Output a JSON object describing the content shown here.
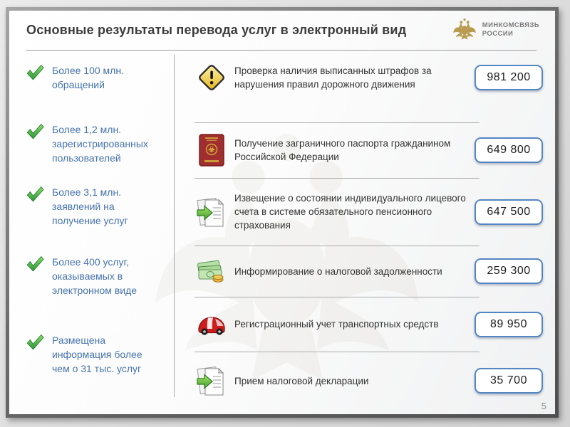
{
  "slide": {
    "title": "Основные результаты перевода услуг в электронный вид",
    "page_number": "5"
  },
  "logo": {
    "line1": "МИНКОМСВЯЗЬ",
    "line2": "РОССИИ"
  },
  "achievements": {
    "items": [
      {
        "text": "Более 100 млн. обращений"
      },
      {
        "text": "Более 1,2 млн. зарегистрированных пользователей"
      },
      {
        "text": "Более 3,1 млн. заявлений на получение услуг"
      },
      {
        "text": "Более 400 услуг, оказываемых в электронном виде"
      },
      {
        "text": "Размещена информация более чем о 31 тыс. услуг"
      }
    ]
  },
  "services": {
    "rows": [
      {
        "icon": "traffic-fine-warning-icon",
        "label": "Проверка наличия выписанных штрафов за нарушения правил дорожного движения",
        "value": "981 200"
      },
      {
        "icon": "passport-icon",
        "label": "Получение заграничного паспорта гражданином Российской Федерации",
        "value": "649 800"
      },
      {
        "icon": "document-arrow-icon",
        "label": "Извещение о состоянии индивидуального лицевого счета в системе обязательного пенсионного страхования",
        "value": "647 500"
      },
      {
        "icon": "money-icon",
        "label": "Информирование о налоговой задолженности",
        "value": "259 300"
      },
      {
        "icon": "car-icon",
        "label": "Регистрационный учет транспортных средств",
        "value": "89 950"
      },
      {
        "icon": "document-arrow-icon",
        "label": "Прием налоговой декларации",
        "value": "35 700"
      }
    ]
  },
  "colors": {
    "accent_blue": "#5486c3",
    "text_blue": "#4674ae",
    "check_green": "#2f9e3c",
    "emblem_gold": "#b89b4e"
  }
}
